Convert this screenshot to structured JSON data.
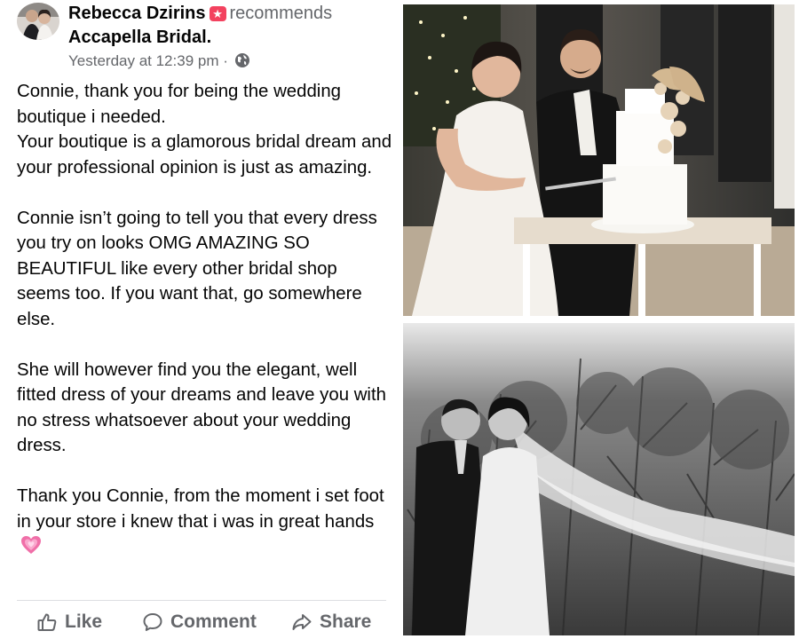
{
  "post": {
    "author": "Rebecca Dzirins",
    "verb": "recommends",
    "page_name": "Accapella Bridal.",
    "timestamp": "Yesterday at 12:39 pm",
    "separator": "·",
    "privacy_icon": "globe-icon",
    "recommend_icon": "recommend-star-badge-icon",
    "paragraphs": [
      "Connie, thank you for being the wedding boutique i needed.\nYour boutique is a glamorous bridal dream and your professional opinion is just as amazing.",
      "Connie isn’t going to tell you that every dress you try on looks OMG AMAZING SO BEAUTIFUL like every other bridal shop seems too. If you want that, go somewhere else.",
      "She will however find you the elegant, well fitted dress of your dreams and leave you with no stress whatsoever about your wedding dress.",
      "Thank you Connie, from the moment i set foot in your store i knew that i was in great hands"
    ],
    "closing_emoji": "growing-heart-emoji",
    "actions": [
      {
        "label": "Like",
        "icon": "thumbs-up-icon"
      },
      {
        "label": "Comment",
        "icon": "comment-bubble-icon"
      },
      {
        "label": "Share",
        "icon": "share-arrow-icon"
      }
    ]
  },
  "photos": [
    {
      "name": "wedding-cake-cutting-photo"
    },
    {
      "name": "bw-kiss-veil-photo"
    }
  ],
  "colors": {
    "secondary_text": "#65676b",
    "badge": "#f3425f",
    "divider": "#dddfe2"
  }
}
